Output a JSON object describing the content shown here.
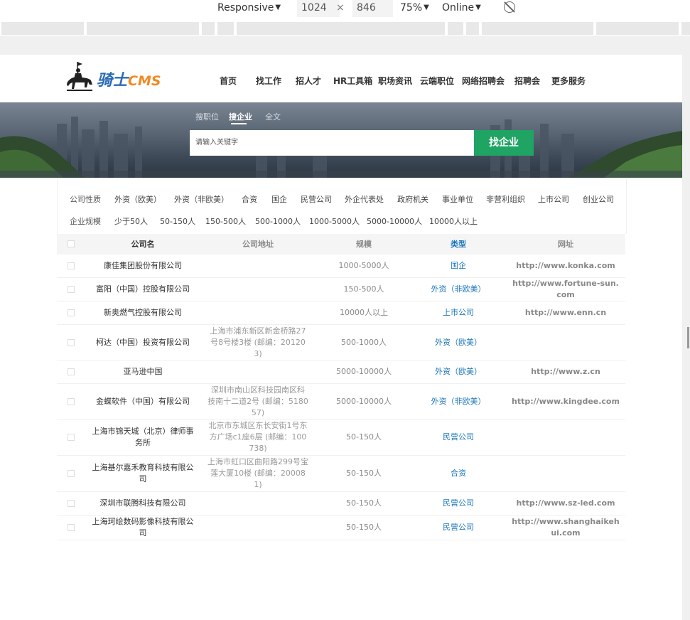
{
  "devtools": {
    "device": "Responsive",
    "width": "1024",
    "times": "×",
    "height": "846",
    "zoom": "75%",
    "network": "Online"
  },
  "logo": {
    "text": "骑士",
    "cms": "CMS"
  },
  "nav": [
    "首页",
    "找工作",
    "招人才",
    "HR工具箱",
    "职场资讯",
    "云端职位",
    "网络招聘会",
    "招聘会",
    "更多服务"
  ],
  "search": {
    "tabs": [
      "搜职位",
      "搜企业",
      "全文"
    ],
    "active_tab": 1,
    "placeholder": "请输入关键字",
    "button": "找企业"
  },
  "filters": {
    "nature_label": "公司性质",
    "nature": [
      "外资（欧美）",
      "外资（非欧美）",
      "合资",
      "国企",
      "民营公司",
      "外企代表处",
      "政府机关",
      "事业单位",
      "非营利组织",
      "上市公司",
      "创业公司"
    ],
    "scale_label": "企业规模",
    "scale": [
      "少于50人",
      "50-150人",
      "150-500人",
      "500-1000人",
      "1000-5000人",
      "5000-10000人",
      "10000人以上"
    ]
  },
  "table": {
    "headers": {
      "name": "公司名",
      "address": "公司地址",
      "scale": "规模",
      "type": "类型",
      "url": "网址"
    },
    "rows": [
      {
        "name": "康佳集团股份有限公司",
        "address": "",
        "scale": "1000-5000人",
        "type": "国企",
        "url": "http://www.konka.com"
      },
      {
        "name": "富阳（中国）控股有限公司",
        "address": "",
        "scale": "150-500人",
        "type": "外资（非欧美）",
        "url": "http://www.fortune-sun.com"
      },
      {
        "name": "新奥燃气控股有限公司",
        "address": "",
        "scale": "10000人以上",
        "type": "上市公司",
        "url": "http://www.enn.cn"
      },
      {
        "name": "柯达（中国）投资有限公司",
        "address": "上海市浦东新区新金桥路27号8号楼3楼 (邮编：201203)",
        "scale": "500-1000人",
        "type": "外资（欧美）",
        "url": ""
      },
      {
        "name": "亚马逊中国",
        "address": "",
        "scale": "5000-10000人",
        "type": "外资（欧美）",
        "url": "http://www.z.cn"
      },
      {
        "name": "金蝶软件（中国）有限公司",
        "address": "深圳市南山区科技园南区科技南十二道2号 (邮编：518057)",
        "scale": "5000-10000人",
        "type": "外资（非欧美）",
        "url": "http://www.kingdee.com"
      },
      {
        "name": "上海市锦天城（北京）律师事务所",
        "address": "北京市东城区东长安街1号东方广场c1座6层 (邮编：100738)",
        "scale": "50-150人",
        "type": "民营公司",
        "url": ""
      },
      {
        "name": "上海基尔嘉禾教育科技有限公司",
        "address": "上海市虹口区曲阳路299号宝莲大厦10楼 (邮编：200081)",
        "scale": "50-150人",
        "type": "合资",
        "url": ""
      },
      {
        "name": "深圳市联腾科技有限公司",
        "address": "",
        "scale": "50-150人",
        "type": "民营公司",
        "url": "http://www.sz-led.com"
      },
      {
        "name": "上海珂绘数码影像科技有限公司",
        "address": "",
        "scale": "50-150人",
        "type": "民营公司",
        "url": "http://www.shanghaikehui.com"
      }
    ]
  }
}
